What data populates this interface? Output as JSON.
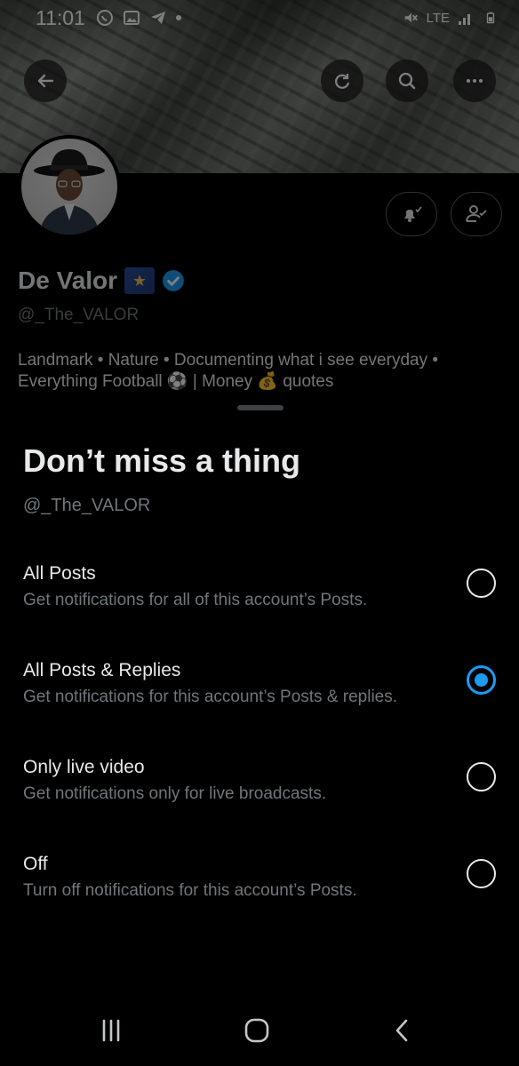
{
  "status_bar": {
    "time": "11:01",
    "network": "LTE",
    "icons": [
      "whatsapp-icon",
      "gallery-icon",
      "telegram-icon",
      "dot-icon",
      "mute-icon",
      "signal-icon",
      "battery-icon"
    ]
  },
  "banner_actions": [
    "back-arrow-icon",
    "refresh-icon",
    "search-icon",
    "more-icon"
  ],
  "profile": {
    "name": "De Valor",
    "handle": "@_The_VALOR",
    "bio_line1": "Landmark • Nature • Documenting what i see everyday •",
    "bio_line2": "Everything Football ⚽ | Money 💰 quotes"
  },
  "sheet": {
    "title": "Don’t miss a thing",
    "handle": "@_The_VALOR",
    "options": [
      {
        "label": "All Posts",
        "description": "Get notifications for all of this account’s Posts.",
        "selected": false
      },
      {
        "label": "All Posts & Replies",
        "description": "Get notifications for this account’s Posts & replies.",
        "selected": true
      },
      {
        "label": "Only live video",
        "description": "Get notifications only for live broadcasts.",
        "selected": false
      },
      {
        "label": "Off",
        "description": "Turn off notifications for this account’s Posts.",
        "selected": false
      }
    ]
  },
  "colors": {
    "accent": "#1d9bf0",
    "background": "#000000",
    "primary_text": "#e7e9ea",
    "secondary_text": "#71767b"
  }
}
